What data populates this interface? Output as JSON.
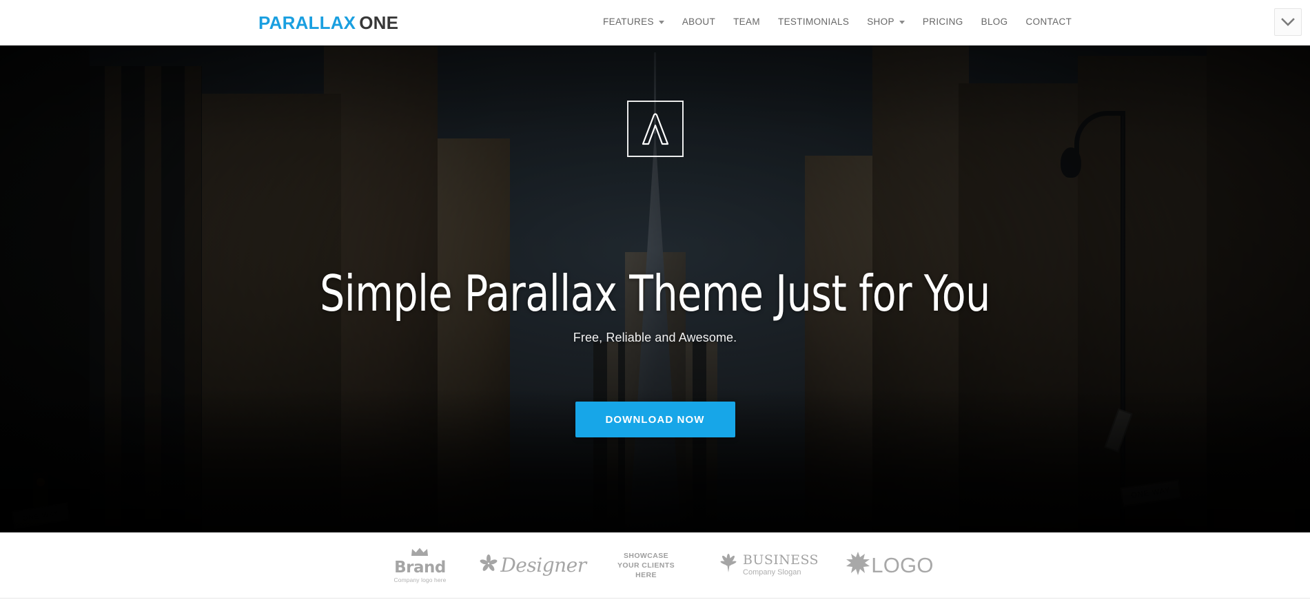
{
  "header": {
    "logo": {
      "primary": "PARALLAX",
      "secondary": "ONE"
    },
    "nav": [
      {
        "label": "FEATURES",
        "has_dropdown": true
      },
      {
        "label": "ABOUT",
        "has_dropdown": false
      },
      {
        "label": "TEAM",
        "has_dropdown": false
      },
      {
        "label": "TESTIMONIALS",
        "has_dropdown": false
      },
      {
        "label": "SHOP",
        "has_dropdown": true
      },
      {
        "label": "PRICING",
        "has_dropdown": false
      },
      {
        "label": "BLOG",
        "has_dropdown": false
      },
      {
        "label": "CONTACT",
        "has_dropdown": false
      }
    ],
    "toggle_icon": "chevron-down-icon"
  },
  "hero": {
    "logo_mark_icon": "lambda-mark-icon",
    "title": "Simple Parallax Theme Just for You",
    "subtitle": "Free, Reliable and Awesome.",
    "cta_label": "DOWNLOAD NOW",
    "cta_color": "#17a6e8",
    "background": "city-street-skyscrapers-photo"
  },
  "clients": [
    {
      "name": "brand",
      "icon": "crown-icon",
      "word": "Brand",
      "tagline": "Company logo here"
    },
    {
      "name": "designer",
      "icon": "flower-icon",
      "word": "Designer",
      "tagline": ""
    },
    {
      "name": "showcase",
      "icon": "",
      "line1": "SHOWCASE",
      "line2": "YOUR CLIENTS",
      "line3": "HERE"
    },
    {
      "name": "business",
      "icon": "leaf-icon",
      "word": "BUSINESS",
      "tagline": "Company Slogan"
    },
    {
      "name": "logo",
      "icon": "starburst-icon",
      "word": "LOGO",
      "tagline": ""
    }
  ],
  "colors": {
    "brand_blue": "#1a9fe0",
    "cta_blue": "#17a6e8",
    "logo_dark": "#373737",
    "nav_text": "#666666",
    "client_gray": "#a8a8a8"
  }
}
